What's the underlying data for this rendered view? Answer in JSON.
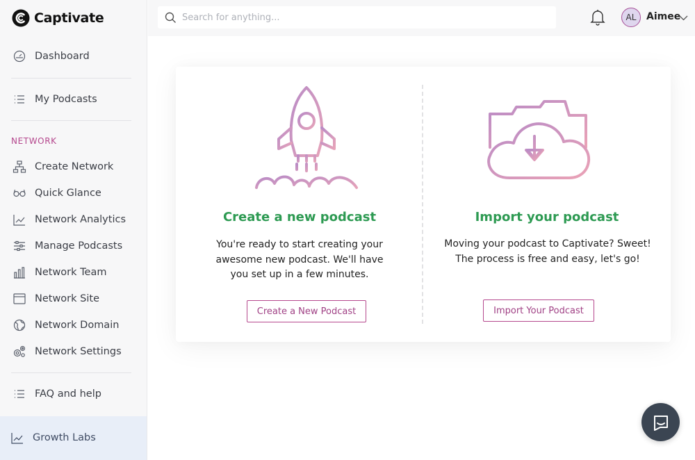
{
  "brand": {
    "name": "Captivate",
    "logo_icon": "captivate-logo-icon"
  },
  "search": {
    "placeholder": "Search for anything..."
  },
  "user": {
    "initials": "AL",
    "name": "Aimee"
  },
  "sidebar": {
    "items_top": [
      {
        "label": "Dashboard",
        "icon": "dashboard-gauge-icon"
      },
      {
        "label": "My Podcasts",
        "icon": "list-icon"
      }
    ],
    "section_title": "NETWORK",
    "network_items": [
      {
        "label": "Create Network",
        "icon": "sitemap-icon"
      },
      {
        "label": "Quick Glance",
        "icon": "glasses-icon"
      },
      {
        "label": "Network Analytics",
        "icon": "trend-chart-icon"
      },
      {
        "label": "Manage Podcasts",
        "icon": "sliders-icon"
      },
      {
        "label": "Network Team",
        "icon": "bar-chart-team-icon"
      },
      {
        "label": "Network Site",
        "icon": "browser-window-icon"
      },
      {
        "label": "Network Domain",
        "icon": "globe-icon"
      },
      {
        "label": "Network Settings",
        "icon": "gears-icon"
      }
    ],
    "help_item": {
      "label": "FAQ and help",
      "icon": "list-icon"
    },
    "growth_item": {
      "label": "Growth Labs",
      "icon": "trend-chart-icon"
    }
  },
  "create": {
    "title": "Create a new podcast",
    "description": "You're ready to start creating your awesome new podcast. We'll have you set up in a few minutes.",
    "button": "Create a New Podcast",
    "illustration": "rocket-launch-icon"
  },
  "import": {
    "title": "Import your podcast",
    "description": "Moving your podcast to Captivate? Sweet! The process is free and easy, let's go!",
    "button": "Import Your Podcast",
    "illustration": "cloud-download-icon"
  },
  "colors": {
    "accent_pink": "#b5478d",
    "title_green": "#2d9a52",
    "sidebar_bg": "#f7f7f8",
    "growth_bg": "#e8eef8",
    "chat_bg": "#3b4552"
  }
}
